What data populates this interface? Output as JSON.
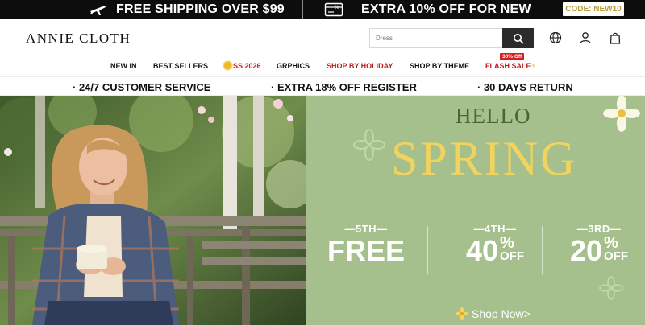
{
  "promo_bar": {
    "shipping_text": "FREE SHIPPING OVER $99",
    "discount_text": "EXTRA 10% OFF FOR NEW",
    "code_text": "CODE: NEW10",
    "icons": [
      "airplane-icon",
      "discount-card-icon"
    ]
  },
  "header": {
    "logo": "ANNIE CLOTH",
    "search": {
      "placeholder": "Dress",
      "value": ""
    },
    "icons": [
      "search-icon",
      "globe-icon",
      "user-icon",
      "shopping-bag-icon"
    ]
  },
  "nav": {
    "items": [
      "NEW IN",
      "BEST SELLERS",
      "SS 2026",
      "GRPHICS",
      "SHOP BY HOLIDAY",
      "SHOP BY THEME",
      "FLASH SALE"
    ],
    "flash_badge": "30% Off"
  },
  "services": {
    "items": [
      "24/7 CUSTOMER SERVICE",
      "EXTRA 18% OFF REGISTER",
      "30 DAYS RETURN"
    ]
  },
  "hero": {
    "hello": "HELLO",
    "headline": "SPRING",
    "offers": [
      {
        "label": "—5TH—",
        "value": "FREE",
        "percent": "",
        "unit": ""
      },
      {
        "label": "—4TH—",
        "value": "40",
        "percent": "%",
        "unit": "OFF"
      },
      {
        "label": "—3RD—",
        "value": "20",
        "percent": "%",
        "unit": "OFF"
      }
    ],
    "cta": "Shop Now>"
  },
  "colors": {
    "promo_bg": "#0d0d0d",
    "code_text": "#b99b3b",
    "nav_red": "#c41a1a",
    "hero_green": "#a5c08c",
    "spring_yellow": "#f2d35d",
    "hello_green": "#4b6336"
  }
}
